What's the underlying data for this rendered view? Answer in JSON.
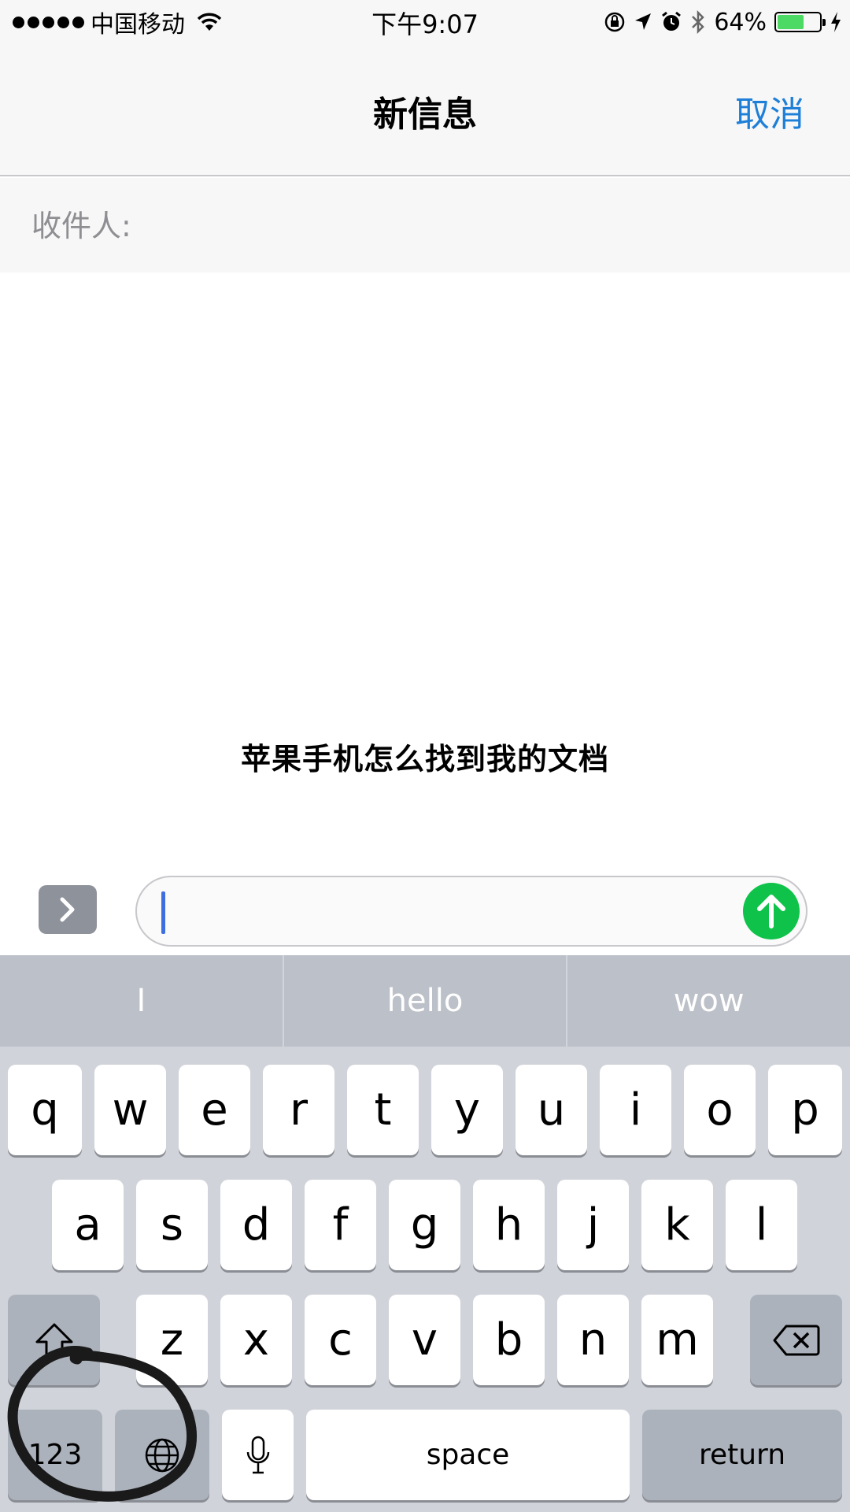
{
  "status_bar": {
    "carrier": "中国移动",
    "time": "下午9:07",
    "battery_percent": "64%",
    "battery_level": 0.64,
    "icons": [
      "signal-dots",
      "wifi-icon",
      "orientation-lock-icon",
      "location-arrow-icon",
      "alarm-icon",
      "bluetooth-icon",
      "battery-icon",
      "charging-icon"
    ]
  },
  "nav": {
    "title": "新信息",
    "cancel_label": "取消"
  },
  "recipient": {
    "label": "收件人:"
  },
  "caption": "苹果手机怎么找到我的文档",
  "compose": {
    "expand_icon": "chevron-right-icon",
    "send_icon": "arrow-up-icon",
    "send_color": "#0fc34a"
  },
  "keyboard": {
    "predictions": [
      "I",
      "hello",
      "wow"
    ],
    "row1": [
      "q",
      "w",
      "e",
      "r",
      "t",
      "y",
      "u",
      "i",
      "o",
      "p"
    ],
    "row2": [
      "a",
      "s",
      "d",
      "f",
      "g",
      "h",
      "j",
      "k",
      "l"
    ],
    "row3": [
      "z",
      "x",
      "c",
      "v",
      "b",
      "n",
      "m"
    ],
    "numbers_label": "123",
    "space_label": "space",
    "return_label": "return"
  },
  "colors": {
    "accent": "#1e7fd8",
    "keyboard_bg": "#d0d3d9",
    "annotation": "#1a1a1a"
  }
}
